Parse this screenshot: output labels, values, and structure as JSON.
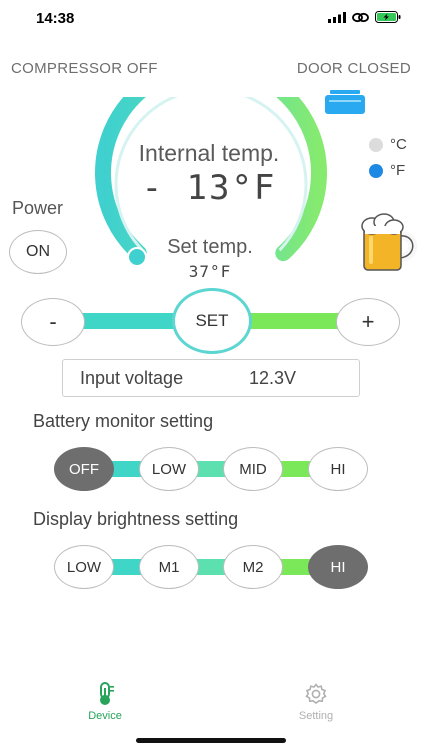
{
  "status_bar": {
    "time": "14:38"
  },
  "header": {
    "compressor_status": "COMPRESSOR OFF",
    "door_status": "DOOR CLOSED"
  },
  "gauge": {
    "internal_label": "Internal temp.",
    "internal_value": "- 13°F",
    "set_label": "Set temp.",
    "set_value": "37°F"
  },
  "units": {
    "options": [
      {
        "label": "°C",
        "selected": false,
        "color": "#dcdcdc"
      },
      {
        "label": "°F",
        "selected": true,
        "color": "#1e88e5"
      }
    ]
  },
  "power": {
    "label": "Power",
    "button": "ON"
  },
  "temp_adjust": {
    "minus": "-",
    "set": "SET",
    "plus": "+"
  },
  "voltage": {
    "label": "Input voltage",
    "value": "12.3V"
  },
  "battery_monitor": {
    "title": "Battery monitor setting",
    "options": [
      "OFF",
      "LOW",
      "MID",
      "HI"
    ],
    "selected": "OFF"
  },
  "brightness": {
    "title": "Display brightness setting",
    "options": [
      "LOW",
      "M1",
      "M2",
      "HI"
    ],
    "selected": "HI"
  },
  "tabs": [
    {
      "label": "Device",
      "active": true,
      "icon": "thermometer-icon"
    },
    {
      "label": "Setting",
      "active": false,
      "icon": "gear-icon"
    }
  ],
  "colors": {
    "accent_teal": "#3fd6c8",
    "accent_green": "#7be85a",
    "active_tab": "#27a35a",
    "inactive_tab": "#b0b0b0",
    "selected_option": "#6e6e6e"
  }
}
